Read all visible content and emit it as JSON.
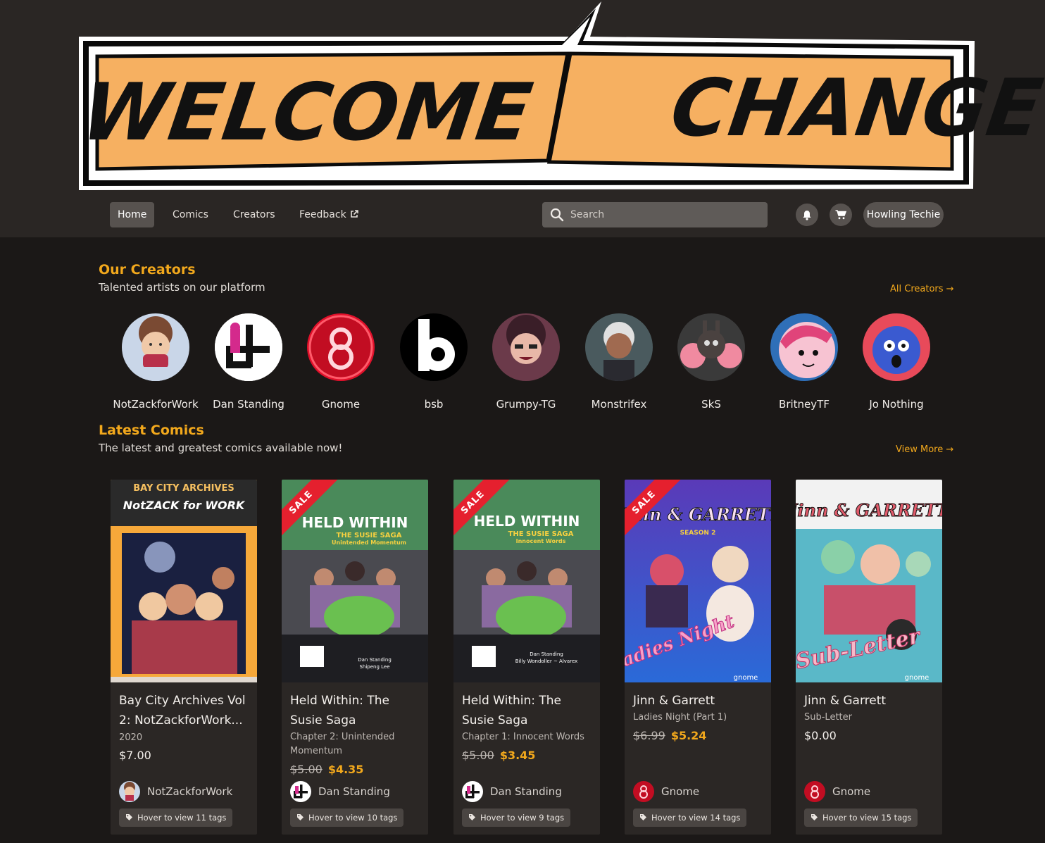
{
  "banner": {
    "word1": "WELCOME",
    "word2": "CHANGE"
  },
  "nav": {
    "home": "Home",
    "comics": "Comics",
    "creators": "Creators",
    "feedback": "Feedback"
  },
  "search": {
    "placeholder": "Search"
  },
  "user": {
    "name": "Howling Techie"
  },
  "creators_section": {
    "title": "Our Creators",
    "subtitle": "Talented artists on our platform",
    "link": "All Creators →",
    "items": [
      {
        "name": "NotZackforWork"
      },
      {
        "name": "Dan Standing"
      },
      {
        "name": "Gnome"
      },
      {
        "name": "bsb"
      },
      {
        "name": "Grumpy-TG"
      },
      {
        "name": "Monstrifex"
      },
      {
        "name": "SkS"
      },
      {
        "name": "BritneyTF"
      },
      {
        "name": "Jo Nothing"
      }
    ]
  },
  "comics_section": {
    "title": "Latest Comics",
    "subtitle": "The latest and greatest comics available now!",
    "link": "View More →",
    "sale_label": "SALE",
    "items": [
      {
        "cover_title": "BAY CITY ARCHIVES",
        "cover_sub": "NotZACK for WORK",
        "title": "Bay City Archives Vol 2: NotZackforWork...",
        "subtitle": "2020",
        "price": "$7.00",
        "creator": "NotZackforWork",
        "tags": "Hover to view 11 tags"
      },
      {
        "cover_title": "HELD WITHIN",
        "cover_sub": "THE SUSIE SAGA",
        "cover_sub2": "Unintended Momentum",
        "cover_credit": "Dan Standing",
        "cover_credit2": "Shipeng Lee",
        "title": "Held Within: The Susie Saga",
        "subtitle": "Chapter 2: Unintended Momentum",
        "old_price": "$5.00",
        "price": "$4.35",
        "creator": "Dan Standing",
        "tags": "Hover to view 10 tags"
      },
      {
        "cover_title": "HELD WITHIN",
        "cover_sub": "THE SUSIE SAGA",
        "cover_sub2": "Innocent Words",
        "cover_credit": "Dan Standing",
        "cover_credit2": "Billy Wondoller ~ Alvarex",
        "title": "Held Within: The Susie Saga",
        "subtitle": "Chapter 1: Innocent Words",
        "old_price": "$5.00",
        "price": "$3.45",
        "creator": "Dan Standing",
        "tags": "Hover to view 9 tags"
      },
      {
        "cover_title": "Jinn & GARRETT",
        "cover_sub": "SEASON 2",
        "cover_sub2": "Ladies Night",
        "cover_credit": "gnome",
        "title": "Jinn & Garrett",
        "subtitle": "Ladies Night (Part 1)",
        "old_price": "$6.99",
        "price": "$5.24",
        "creator": "Gnome",
        "tags": "Hover to view 14 tags"
      },
      {
        "cover_title": "Jinn & GARRETT",
        "cover_sub2": "Sub-Letter",
        "cover_credit": "gnome",
        "title": "Jinn & Garrett",
        "subtitle": "Sub-Letter",
        "price": "$0.00",
        "creator": "Gnome",
        "tags": "Hover to view 15 tags"
      }
    ]
  },
  "colors": {
    "accent": "#f2a81c",
    "sale": "#e5202e",
    "banner": "#f6b061"
  }
}
